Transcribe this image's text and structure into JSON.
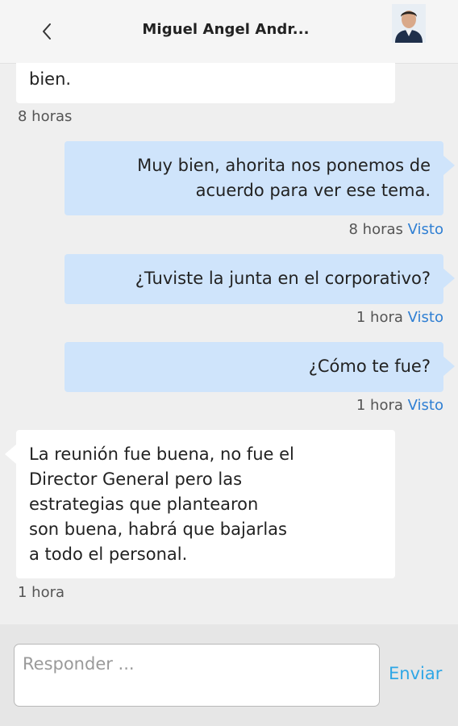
{
  "header": {
    "back_icon": "chevron-left-icon",
    "contact_name": "Miguel Angel Andr..."
  },
  "messages": [
    {
      "direction": "in",
      "text": "bien.",
      "time": "8 horas"
    },
    {
      "direction": "out",
      "text": "Muy bien, ahorita nos ponemos de\nacuerdo para ver ese tema.",
      "time": "8 horas",
      "status": "Visto"
    },
    {
      "direction": "out",
      "text": "¿Tuviste la junta en el corporativo?",
      "time": "1 hora",
      "status": "Visto"
    },
    {
      "direction": "out",
      "text": "¿Cómo te fue?",
      "time": "1 hora",
      "status": "Visto"
    },
    {
      "direction": "in",
      "text": "La reunión fue buena, no fue el\nDirector General pero las\nestrategias que plantearon\nson buena, habrá que bajarlas\na todo el personal.",
      "time": "1 hora"
    }
  ],
  "composer": {
    "placeholder": "Responder ...",
    "send_label": "Enviar"
  },
  "colors": {
    "outgoing_bubble": "#cfe4fb",
    "incoming_bubble": "#ffffff",
    "seen_status": "#2f7fd3",
    "send_button": "#2fa7e6"
  }
}
